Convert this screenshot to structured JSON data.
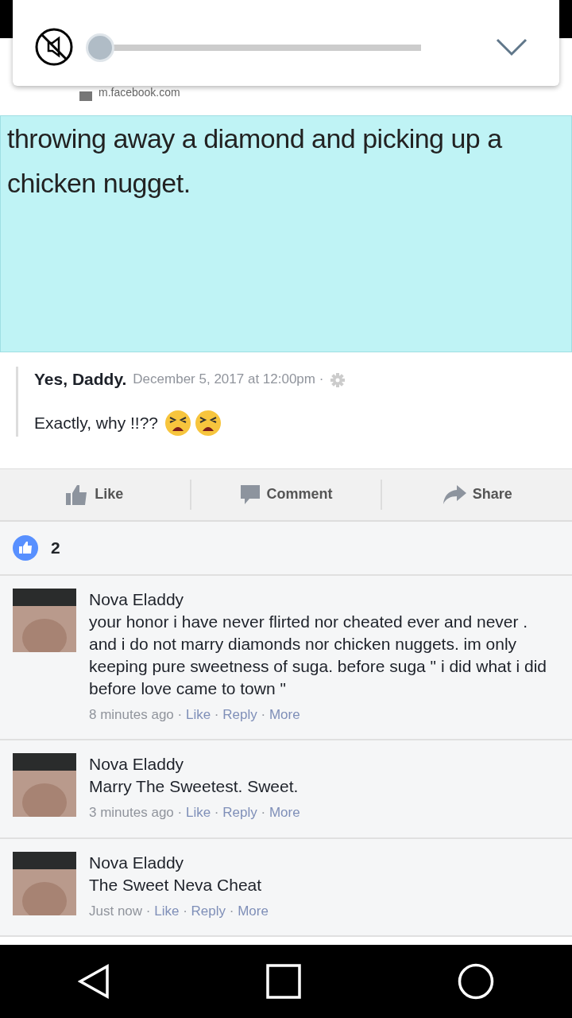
{
  "volume_panel": {
    "muted": true,
    "level": 0
  },
  "post": {
    "source": "m.facebook.com",
    "image_text": "throwing away a diamond and picking up a chicken nugget.",
    "quote": {
      "author": "Yes, Daddy.",
      "time": "December 5, 2017 at 12:00pm ·",
      "text": "Exactly, why !!??",
      "emojis": [
        {
          "kind": "tired-face"
        },
        {
          "kind": "tired-face"
        }
      ]
    }
  },
  "actions": [
    {
      "kind": "like",
      "label": "Like"
    },
    {
      "kind": "comment",
      "label": "Comment"
    },
    {
      "kind": "share",
      "label": "Share"
    }
  ],
  "like_count": "2",
  "comments": [
    {
      "author": "Nova Eladdy",
      "text": "your honor i have never flirted nor cheated ever and never . and i do not marry diamonds nor chicken nuggets. im only keeping pure sweetness of suga. before suga \" i did what i did before love came to town \"",
      "time": "8 minutes ago",
      "separator": "·",
      "links": [
        "Like",
        "Reply",
        "More"
      ]
    },
    {
      "author": "Nova Eladdy",
      "text": "Marry The Sweetest. Sweet.",
      "time": "3 minutes ago",
      "separator": "·",
      "links": [
        "Like",
        "Reply",
        "More"
      ]
    },
    {
      "author": "Nova Eladdy",
      "text": "The Sweet Neva Cheat",
      "time": "Just now",
      "separator": "·",
      "links": [
        "Like",
        "Reply",
        "More"
      ]
    }
  ]
}
